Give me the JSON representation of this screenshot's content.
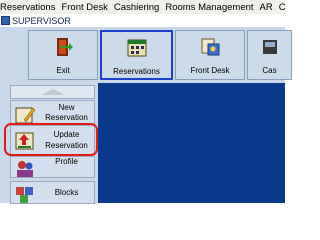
{
  "menu": [
    "Reservations",
    "Front Desk",
    "Cashiering",
    "Rooms Management",
    "AR",
    "C"
  ],
  "window": {
    "title": "SUPERVISOR"
  },
  "toolbar": {
    "buttons": [
      {
        "label": "Exit",
        "icon": "exit-door-icon"
      },
      {
        "label": "Reservations",
        "icon": "reservations-calendar-icon",
        "active": true
      },
      {
        "label": "Front Desk",
        "icon": "front-desk-icon"
      },
      {
        "label": "Cas",
        "icon": "cashiering-icon"
      }
    ]
  },
  "side_menu": {
    "items": [
      {
        "line1": "New",
        "line2": "Reservation"
      },
      {
        "line1": "Update",
        "line2": "Reservation",
        "highlighted": true
      },
      {
        "line1": "Profile"
      },
      {
        "line1": "Blocks"
      }
    ]
  },
  "colors": {
    "highlight": "#e41a1a",
    "main_background": "#0a3a8c",
    "panel": "#c9d8e9"
  }
}
